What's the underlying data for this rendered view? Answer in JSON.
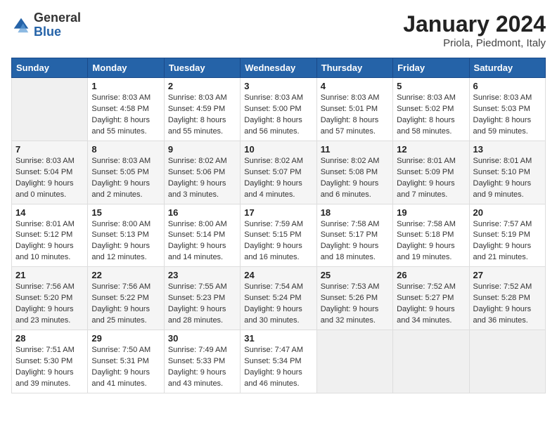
{
  "header": {
    "logo_general": "General",
    "logo_blue": "Blue",
    "month_title": "January 2024",
    "location": "Priola, Piedmont, Italy"
  },
  "columns": [
    "Sunday",
    "Monday",
    "Tuesday",
    "Wednesday",
    "Thursday",
    "Friday",
    "Saturday"
  ],
  "weeks": [
    [
      {
        "day": "",
        "empty": true
      },
      {
        "day": "1",
        "sunrise": "Sunrise: 8:03 AM",
        "sunset": "Sunset: 4:58 PM",
        "daylight": "Daylight: 8 hours and 55 minutes."
      },
      {
        "day": "2",
        "sunrise": "Sunrise: 8:03 AM",
        "sunset": "Sunset: 4:59 PM",
        "daylight": "Daylight: 8 hours and 55 minutes."
      },
      {
        "day": "3",
        "sunrise": "Sunrise: 8:03 AM",
        "sunset": "Sunset: 5:00 PM",
        "daylight": "Daylight: 8 hours and 56 minutes."
      },
      {
        "day": "4",
        "sunrise": "Sunrise: 8:03 AM",
        "sunset": "Sunset: 5:01 PM",
        "daylight": "Daylight: 8 hours and 57 minutes."
      },
      {
        "day": "5",
        "sunrise": "Sunrise: 8:03 AM",
        "sunset": "Sunset: 5:02 PM",
        "daylight": "Daylight: 8 hours and 58 minutes."
      },
      {
        "day": "6",
        "sunrise": "Sunrise: 8:03 AM",
        "sunset": "Sunset: 5:03 PM",
        "daylight": "Daylight: 8 hours and 59 minutes."
      }
    ],
    [
      {
        "day": "7",
        "sunrise": "Sunrise: 8:03 AM",
        "sunset": "Sunset: 5:04 PM",
        "daylight": "Daylight: 9 hours and 0 minutes."
      },
      {
        "day": "8",
        "sunrise": "Sunrise: 8:03 AM",
        "sunset": "Sunset: 5:05 PM",
        "daylight": "Daylight: 9 hours and 2 minutes."
      },
      {
        "day": "9",
        "sunrise": "Sunrise: 8:02 AM",
        "sunset": "Sunset: 5:06 PM",
        "daylight": "Daylight: 9 hours and 3 minutes."
      },
      {
        "day": "10",
        "sunrise": "Sunrise: 8:02 AM",
        "sunset": "Sunset: 5:07 PM",
        "daylight": "Daylight: 9 hours and 4 minutes."
      },
      {
        "day": "11",
        "sunrise": "Sunrise: 8:02 AM",
        "sunset": "Sunset: 5:08 PM",
        "daylight": "Daylight: 9 hours and 6 minutes."
      },
      {
        "day": "12",
        "sunrise": "Sunrise: 8:01 AM",
        "sunset": "Sunset: 5:09 PM",
        "daylight": "Daylight: 9 hours and 7 minutes."
      },
      {
        "day": "13",
        "sunrise": "Sunrise: 8:01 AM",
        "sunset": "Sunset: 5:10 PM",
        "daylight": "Daylight: 9 hours and 9 minutes."
      }
    ],
    [
      {
        "day": "14",
        "sunrise": "Sunrise: 8:01 AM",
        "sunset": "Sunset: 5:12 PM",
        "daylight": "Daylight: 9 hours and 10 minutes."
      },
      {
        "day": "15",
        "sunrise": "Sunrise: 8:00 AM",
        "sunset": "Sunset: 5:13 PM",
        "daylight": "Daylight: 9 hours and 12 minutes."
      },
      {
        "day": "16",
        "sunrise": "Sunrise: 8:00 AM",
        "sunset": "Sunset: 5:14 PM",
        "daylight": "Daylight: 9 hours and 14 minutes."
      },
      {
        "day": "17",
        "sunrise": "Sunrise: 7:59 AM",
        "sunset": "Sunset: 5:15 PM",
        "daylight": "Daylight: 9 hours and 16 minutes."
      },
      {
        "day": "18",
        "sunrise": "Sunrise: 7:58 AM",
        "sunset": "Sunset: 5:17 PM",
        "daylight": "Daylight: 9 hours and 18 minutes."
      },
      {
        "day": "19",
        "sunrise": "Sunrise: 7:58 AM",
        "sunset": "Sunset: 5:18 PM",
        "daylight": "Daylight: 9 hours and 19 minutes."
      },
      {
        "day": "20",
        "sunrise": "Sunrise: 7:57 AM",
        "sunset": "Sunset: 5:19 PM",
        "daylight": "Daylight: 9 hours and 21 minutes."
      }
    ],
    [
      {
        "day": "21",
        "sunrise": "Sunrise: 7:56 AM",
        "sunset": "Sunset: 5:20 PM",
        "daylight": "Daylight: 9 hours and 23 minutes."
      },
      {
        "day": "22",
        "sunrise": "Sunrise: 7:56 AM",
        "sunset": "Sunset: 5:22 PM",
        "daylight": "Daylight: 9 hours and 25 minutes."
      },
      {
        "day": "23",
        "sunrise": "Sunrise: 7:55 AM",
        "sunset": "Sunset: 5:23 PM",
        "daylight": "Daylight: 9 hours and 28 minutes."
      },
      {
        "day": "24",
        "sunrise": "Sunrise: 7:54 AM",
        "sunset": "Sunset: 5:24 PM",
        "daylight": "Daylight: 9 hours and 30 minutes."
      },
      {
        "day": "25",
        "sunrise": "Sunrise: 7:53 AM",
        "sunset": "Sunset: 5:26 PM",
        "daylight": "Daylight: 9 hours and 32 minutes."
      },
      {
        "day": "26",
        "sunrise": "Sunrise: 7:52 AM",
        "sunset": "Sunset: 5:27 PM",
        "daylight": "Daylight: 9 hours and 34 minutes."
      },
      {
        "day": "27",
        "sunrise": "Sunrise: 7:52 AM",
        "sunset": "Sunset: 5:28 PM",
        "daylight": "Daylight: 9 hours and 36 minutes."
      }
    ],
    [
      {
        "day": "28",
        "sunrise": "Sunrise: 7:51 AM",
        "sunset": "Sunset: 5:30 PM",
        "daylight": "Daylight: 9 hours and 39 minutes."
      },
      {
        "day": "29",
        "sunrise": "Sunrise: 7:50 AM",
        "sunset": "Sunset: 5:31 PM",
        "daylight": "Daylight: 9 hours and 41 minutes."
      },
      {
        "day": "30",
        "sunrise": "Sunrise: 7:49 AM",
        "sunset": "Sunset: 5:33 PM",
        "daylight": "Daylight: 9 hours and 43 minutes."
      },
      {
        "day": "31",
        "sunrise": "Sunrise: 7:47 AM",
        "sunset": "Sunset: 5:34 PM",
        "daylight": "Daylight: 9 hours and 46 minutes."
      },
      {
        "day": "",
        "empty": true
      },
      {
        "day": "",
        "empty": true
      },
      {
        "day": "",
        "empty": true
      }
    ]
  ]
}
